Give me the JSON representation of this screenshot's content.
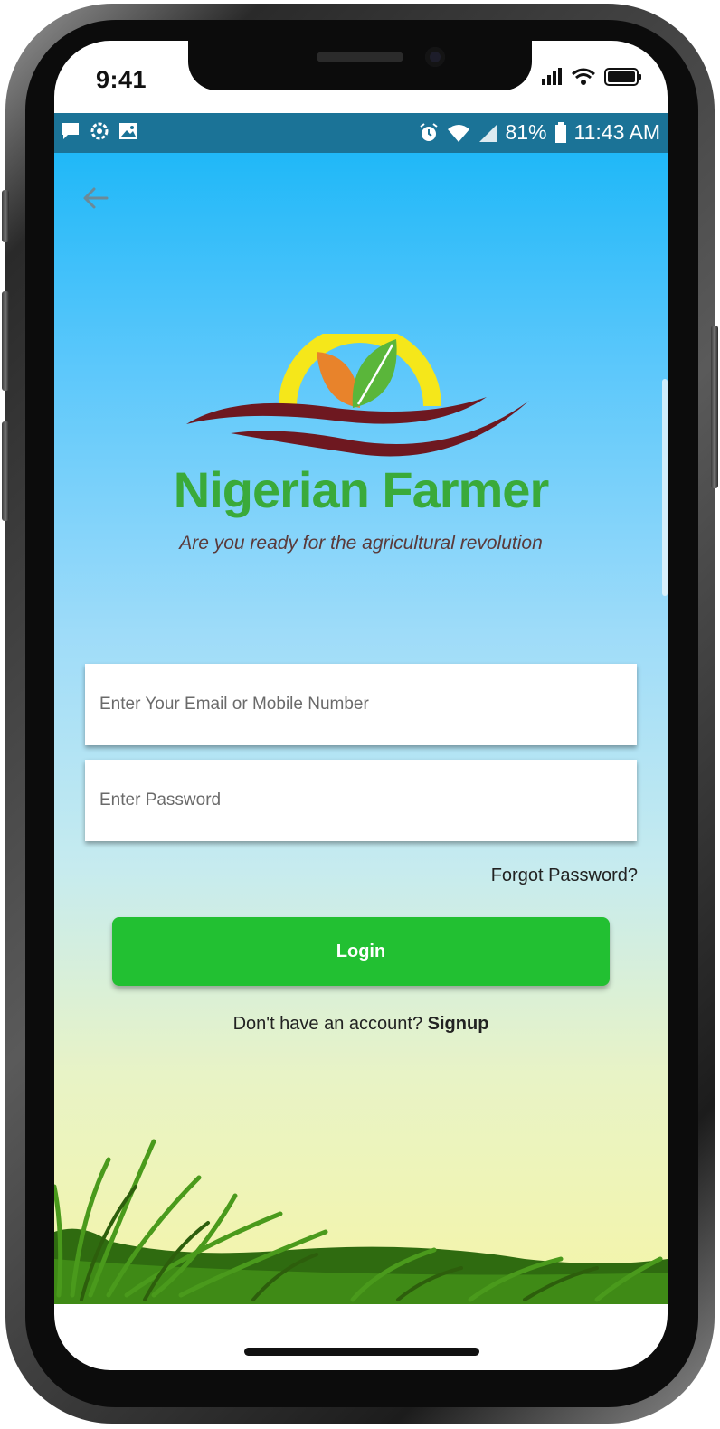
{
  "ios_status": {
    "time": "9:41"
  },
  "android_status": {
    "battery": "81%",
    "time": "11:43 AM"
  },
  "brand": {
    "name": "Nigerian Farmer",
    "tagline": "Are you ready for the agricultural revolution"
  },
  "login_form": {
    "email_placeholder": "Enter Your Email or Mobile Number",
    "password_placeholder": "Enter Password",
    "forgot_label": "Forgot Password?",
    "login_label": "Login",
    "signup_prompt": "Don't have an account?",
    "signup_label": "Signup"
  },
  "colors": {
    "login_button": "#22c032",
    "brand_green": "#3aaa3a",
    "status_bar": "#1b7397",
    "sky_top": "#20b8f8",
    "ground": "#f5f5a8"
  },
  "icons": [
    "back-arrow-icon",
    "signal-icon",
    "wifi-icon",
    "battery-icon",
    "message-icon",
    "settings-icon",
    "image-icon",
    "alarm-icon"
  ]
}
